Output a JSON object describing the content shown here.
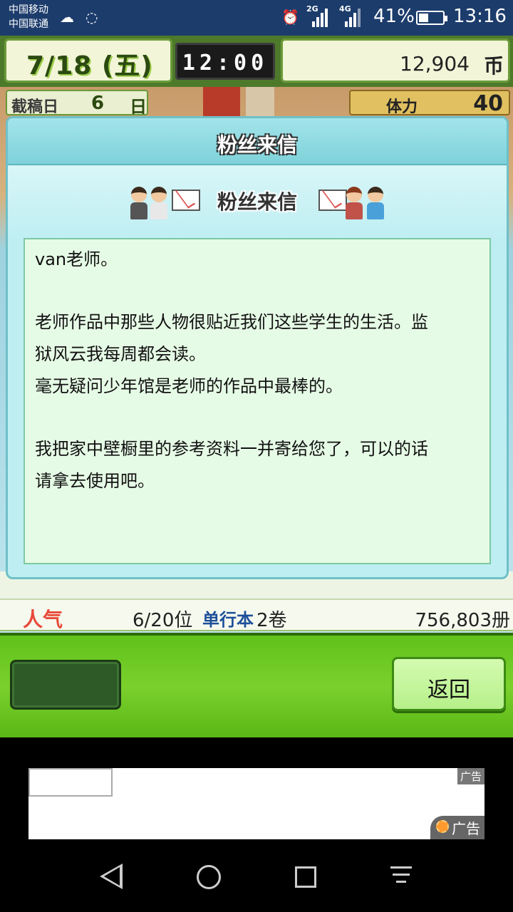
{
  "status_bar": {
    "carrier1": "中国移动",
    "carrier2": "中国联通",
    "net1": "2G",
    "net2": "4G",
    "battery": "41%",
    "battery_level": 0.41,
    "time": "13:16"
  },
  "hud": {
    "date": "7/18 (五)",
    "clock": "12:00",
    "money": "12,904",
    "money_unit": "币",
    "deadline_label": "截稿日",
    "deadline_value": "6",
    "deadline_unit": "日",
    "stamina_label": "体力",
    "stamina_value": "40"
  },
  "dialog": {
    "title": "粉丝来信",
    "subtitle": "粉丝来信",
    "letter_lines": [
      "van老师。",
      "",
      "老师作品中那些人物很贴近我们这些学生的生活。监",
      "狱风云我每周都会读。",
      "毫无疑问少年馆是老师的作品中最棒的。",
      "",
      "我把家中壁橱里的参考资料一并寄给您了，可以的话",
      "请拿去使用吧。"
    ]
  },
  "stats": {
    "popularity_label": "人气",
    "rank": "6/20位",
    "tag": "单行本",
    "volumes": "2卷",
    "copies": "756,803册"
  },
  "buttons": {
    "back_label": "返回"
  },
  "ad": {
    "tag_small": "广告",
    "tag_large": "广告"
  },
  "colors": {
    "status_bar": "#1c3c6c",
    "green_bar": "#6ccb22",
    "dialog_bg": "#bfeef2",
    "letter_bg": "#e6fbe6",
    "popularity": "#e84a3a"
  }
}
